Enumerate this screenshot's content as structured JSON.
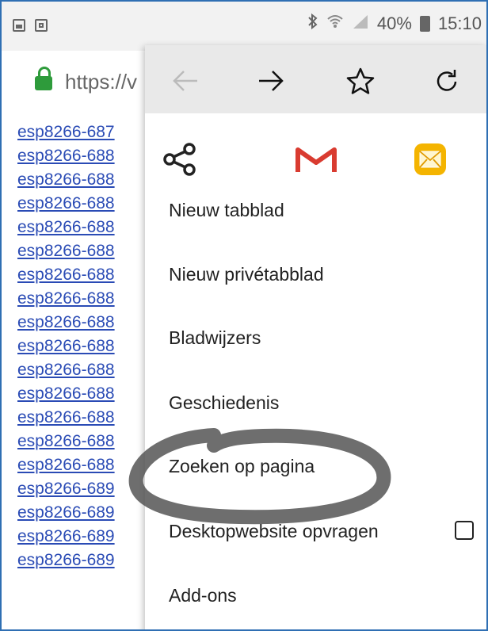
{
  "status_bar": {
    "battery": "40%",
    "time": "15:10",
    "icons": [
      "image-icon",
      "gallery-icon",
      "bluetooth-icon",
      "wifi-icon",
      "signal-icon",
      "battery-icon"
    ]
  },
  "address_bar": {
    "url": "https://v",
    "lock_color": "#2e9b3b"
  },
  "links": [
    "esp8266-687",
    "esp8266-688",
    "esp8266-688",
    "esp8266-688",
    "esp8266-688",
    "esp8266-688",
    "esp8266-688",
    "esp8266-688",
    "esp8266-688",
    "esp8266-688",
    "esp8266-688",
    "esp8266-688",
    "esp8266-688",
    "esp8266-688",
    "esp8266-688",
    "esp8266-689",
    "esp8266-689",
    "esp8266-689",
    "esp8266-689"
  ],
  "menu": {
    "toolbar_icons": [
      "back-icon",
      "forward-icon",
      "bookmark-star-icon",
      "reload-icon"
    ],
    "share_icons": [
      "share-icon",
      "gmail-icon",
      "email-icon"
    ],
    "items": [
      {
        "label": "Nieuw tabblad"
      },
      {
        "label": "Nieuw privétabblad"
      },
      {
        "label": "Bladwijzers"
      },
      {
        "label": "Geschiedenis"
      },
      {
        "label": "Zoeken op pagina"
      },
      {
        "label": "Desktopwebsite opvragen",
        "checkbox": false
      },
      {
        "label": "Add-ons"
      }
    ]
  },
  "colors": {
    "link": "#2a4bb5",
    "frame_border": "#2f6fb3",
    "toolbar_bg": "#e9e9e9",
    "annotation_circle": "#555555"
  }
}
